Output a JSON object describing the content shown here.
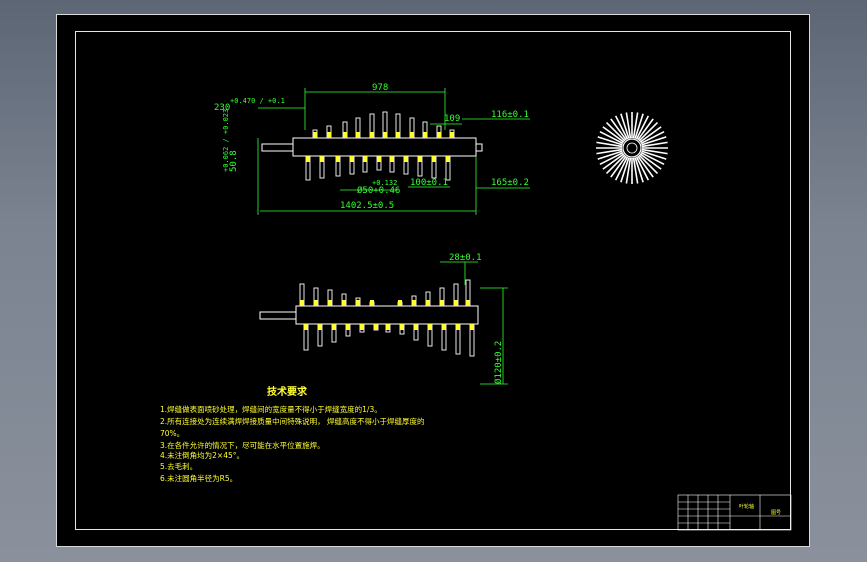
{
  "top_view": {
    "dim_overall_span": "978",
    "dim_shaft_end": "230",
    "dim_shaft_end_tol": "+0.470 / +0.1",
    "dim_left_dia": "50.8",
    "dim_left_dia_tol": "+0.062 / +0.023",
    "dim_gap": "109",
    "dim_116": "116±0.1",
    "dim_bore": "Ø50+0.46",
    "dim_bore_tol": "+0.132",
    "dim_100": "100±0.1",
    "dim_165": "165±0.2",
    "dim_total_length": "1402.5±0.5"
  },
  "front_view": {
    "dim_28": "28±0.1",
    "dim_dia120": "Ø120±0.2"
  },
  "technical_requirements": {
    "title": "技术要求",
    "items": [
      "1.焊缝做表面喷砂处理，焊缝间的宽度量不得小于焊缝宽度的1/3。",
      "2.所有连接处为连续满焊焊接质量中间特殊说明，  焊缝高度不得小于焊缝厚度的",
      "70%。",
      "3.在各件允许的情况下，尽可能在水平位置施焊。",
      "4.未注倒角均为2×45°。",
      "5.去毛刺。",
      "6.未注圆角半径为R5。"
    ]
  },
  "title_block": {
    "drawing_name": "叶轮轴",
    "sheet_label": "图号"
  },
  "colors": {
    "dimension": "#33ff33",
    "notes": "#ffff33",
    "geometry": "#ffffff",
    "background": "#000000"
  }
}
